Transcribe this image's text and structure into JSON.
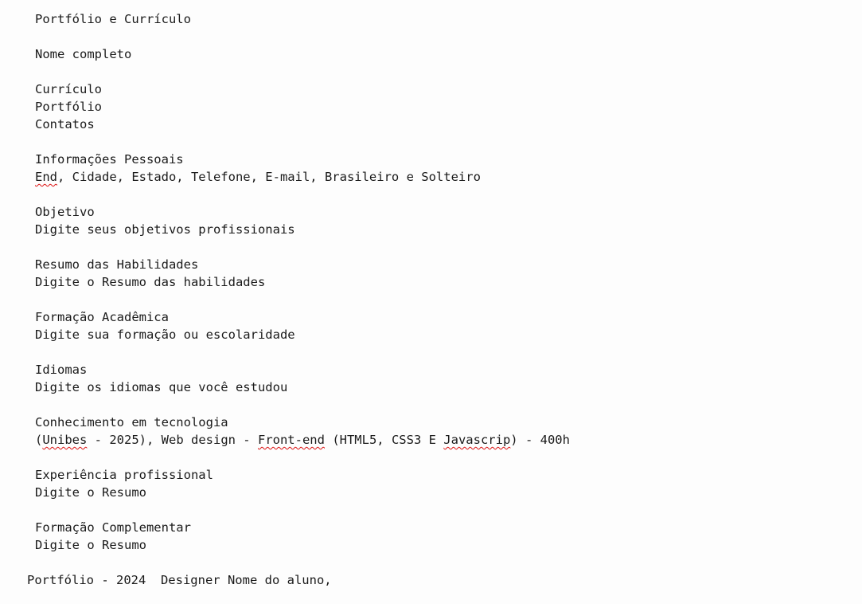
{
  "document": {
    "title": "Portfólio e Currículo",
    "name": "Nome completo",
    "nav": [
      "Currículo",
      "Portfólio",
      "Contatos"
    ],
    "sections": {
      "personal": {
        "heading": "Informações Pessoais",
        "text_word_misspelled": "End",
        "text_rest": ", Cidade, Estado, Telefone, E-mail, Brasileiro e Solteiro"
      },
      "objective": {
        "heading": "Objetivo",
        "text": "Digite seus objetivos profissionais"
      },
      "skills": {
        "heading": "Resumo das Habilidades",
        "text": "Digite o Resumo das habilidades"
      },
      "education": {
        "heading": "Formação Acadêmica",
        "text": "Digite sua formação ou escolaridade"
      },
      "languages": {
        "heading": "Idiomas",
        "text": "Digite os idiomas que você estudou"
      },
      "tech": {
        "heading": "Conhecimento em tecnologia",
        "p1": "(",
        "w1": "Unibes",
        "p2": " - 2025), Web design - ",
        "w2": "Front-end",
        "p3": " (HTML5, CSS3 E ",
        "w3": "Javascrip",
        "p4": ") - 400h"
      },
      "experience": {
        "heading": "Experiência profissional",
        "text": "Digite o Resumo"
      },
      "complementary": {
        "heading": "Formação Complementar",
        "text": "Digite o Resumo"
      }
    },
    "footer": "Portfólio - 2024  Designer Nome do aluno,"
  }
}
